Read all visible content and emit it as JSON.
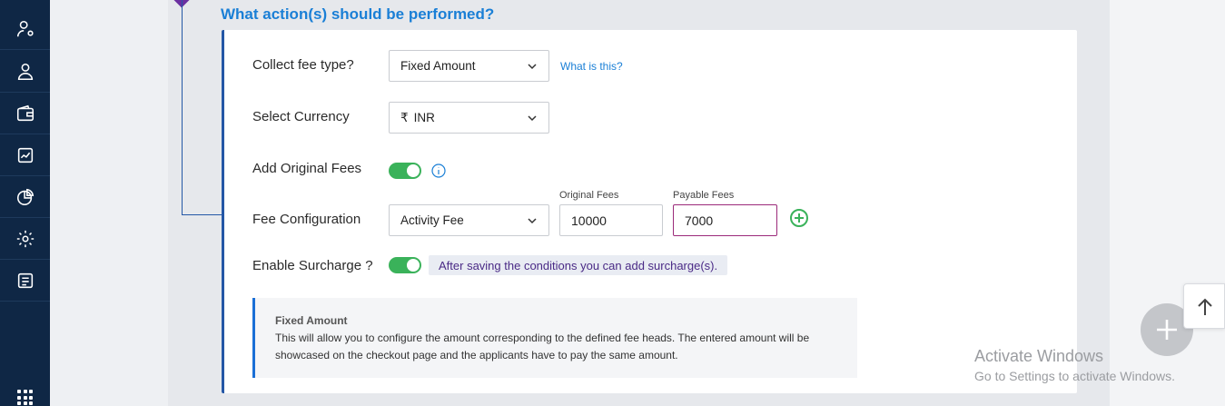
{
  "sidebar": {
    "icons": [
      "user-settings-icon",
      "user-badge-icon",
      "wallet-icon",
      "analytics-icon",
      "pie-chart-icon",
      "gear-icon",
      "document-icon",
      "apps-grid-icon"
    ]
  },
  "section": {
    "title": "What action(s) should be performed?"
  },
  "form": {
    "collect_fee_type": {
      "label": "Collect fee type?",
      "value": "Fixed Amount",
      "help": "What is this?"
    },
    "currency": {
      "label": "Select Currency",
      "symbol": "₹",
      "value": "INR"
    },
    "original_fees_toggle": {
      "label": "Add Original Fees",
      "on": true
    },
    "fee_configuration": {
      "label": "Fee Configuration",
      "fee_head": "Activity Fee",
      "original_caption": "Original Fees",
      "original_value": "10000",
      "payable_caption": "Payable Fees",
      "payable_value": "7000"
    },
    "surcharge": {
      "label": "Enable Surcharge ?",
      "on": true,
      "note": "After saving the conditions you can add surcharge(s)."
    }
  },
  "info_box": {
    "title": "Fixed Amount",
    "body": "This will allow you to configure the amount corresponding to the defined fee heads. The entered amount will be showcased on the checkout page and the applicants have to pay the same amount."
  },
  "watermark": {
    "line1": "Activate Windows",
    "line2": "Go to Settings to activate Windows."
  },
  "colors": {
    "sidebar": "#0f2745",
    "accent": "#1a7fd6",
    "toggle_on": "#3ab25a",
    "active_border": "#9b2a7a"
  }
}
